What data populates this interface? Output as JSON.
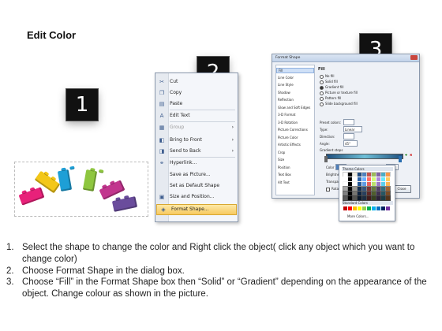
{
  "title": "Edit Color",
  "steps": [
    "1",
    "2",
    "3"
  ],
  "context_menu": {
    "items": [
      {
        "label": "Cut",
        "icon": "scissors-icon",
        "glyph": "✂",
        "disabled": false,
        "submenu": false
      },
      {
        "label": "Copy",
        "icon": "copy-icon",
        "glyph": "❐",
        "disabled": false,
        "submenu": false
      },
      {
        "label": "Paste",
        "icon": "paste-icon",
        "glyph": "▤",
        "disabled": false,
        "submenu": false
      },
      {
        "label": "Edit Text",
        "icon": "edit-text-icon",
        "glyph": "A",
        "disabled": false,
        "submenu": false
      },
      {
        "label": "Group",
        "icon": "group-icon",
        "glyph": "▦",
        "disabled": true,
        "submenu": true
      },
      {
        "label": "Bring to Front",
        "icon": "bring-to-front-icon",
        "glyph": "◧",
        "disabled": false,
        "submenu": true
      },
      {
        "label": "Send to Back",
        "icon": "send-to-back-icon",
        "glyph": "◨",
        "disabled": false,
        "submenu": true
      },
      {
        "label": "Hyperlink...",
        "icon": "hyperlink-icon",
        "glyph": "⚭",
        "disabled": false,
        "submenu": false
      },
      {
        "label": "Save as Picture...",
        "icon": "",
        "glyph": "",
        "disabled": false,
        "submenu": false
      },
      {
        "label": "Set as Default Shape",
        "icon": "",
        "glyph": "",
        "disabled": false,
        "submenu": false
      },
      {
        "label": "Size and Position...",
        "icon": "size-position-icon",
        "glyph": "▣",
        "disabled": false,
        "submenu": false
      },
      {
        "label": "Format Shape...",
        "icon": "format-shape-icon",
        "glyph": "◈",
        "disabled": false,
        "submenu": false,
        "highlighted": true
      }
    ]
  },
  "dialog": {
    "title": "Format Shape",
    "categories": [
      "Fill",
      "Line Color",
      "Line Style",
      "Shadow",
      "Reflection",
      "Glow and Soft Edges",
      "3-D Format",
      "3-D Rotation",
      "Picture Corrections",
      "Picture Color",
      "Artistic Effects",
      "Crop",
      "Size",
      "Position",
      "Text Box",
      "Alt Text"
    ],
    "selected_category": "Fill",
    "fill_heading": "Fill",
    "fill_options": [
      {
        "label": "No fill",
        "selected": false
      },
      {
        "label": "Solid fill",
        "selected": false
      },
      {
        "label": "Gradient fill",
        "selected": true
      },
      {
        "label": "Picture or texture fill",
        "selected": false
      },
      {
        "label": "Pattern fill",
        "selected": false
      },
      {
        "label": "Slide background fill",
        "selected": false
      }
    ],
    "preset_colors_label": "Preset colors:",
    "type_label": "Type:",
    "type_value": "Linear",
    "direction_label": "Direction:",
    "angle_label": "Angle:",
    "angle_value": "45°",
    "gradient_stops_label": "Gradient stops",
    "color_label": "Color",
    "position_label": "Position:",
    "position_value": "99%",
    "brightness_label": "Brightness:",
    "transparency_label": "Transparency:",
    "rotate_label": "Rotate with shape",
    "close_label": "Close",
    "palette": {
      "theme_colors_label": "Theme Colors",
      "standard_colors_label": "Standard Colors",
      "more_colors_label": "More Colors...",
      "theme_row": [
        "#ffffff",
        "#000000",
        "#eeece1",
        "#1f497d",
        "#4f81bd",
        "#c0504d",
        "#9bbb59",
        "#8064a2",
        "#4bacc6",
        "#f79646"
      ],
      "standard_row": [
        "#c00000",
        "#ff0000",
        "#ffc000",
        "#ffff00",
        "#92d050",
        "#00b050",
        "#00b0f0",
        "#0070c0",
        "#002060",
        "#7030a0"
      ]
    }
  },
  "bricks": [
    {
      "color": "#e8217a",
      "name": "pink-brick"
    },
    {
      "color": "#f3c718",
      "name": "yellow-brick"
    },
    {
      "color": "#1e9fd6",
      "name": "blue-brick"
    },
    {
      "color": "#8ec63f",
      "name": "green-brick"
    },
    {
      "color": "#c2358e",
      "name": "magenta-brick"
    },
    {
      "color": "#6a4c9c",
      "name": "purple-brick"
    }
  ],
  "instructions": [
    {
      "num": "1.",
      "text": "Select the shape to change the color and Right click the object( click any object which you want to change color)"
    },
    {
      "num": "2.",
      "text": "Choose Format Shape in the dialog box."
    },
    {
      "num": "3.",
      "text": "Choose “Fill” in the Format Shape box then “Solid” or “Gradient” depending on the appearance of the object. Change colour as shown in the picture."
    }
  ]
}
